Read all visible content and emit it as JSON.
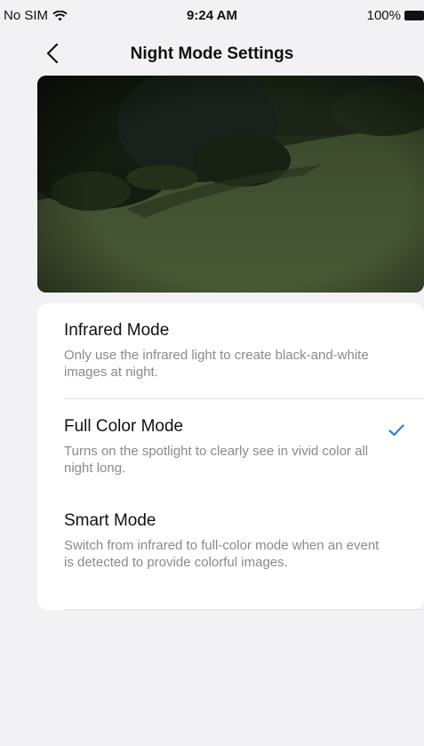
{
  "status_bar": {
    "carrier": "No SIM",
    "time": "9:24 AM",
    "battery": "100%"
  },
  "nav": {
    "title": "Night Mode Settings"
  },
  "options": [
    {
      "title": "Infrared Mode",
      "description": "Only use the infrared light to create black-and-white images at night.",
      "selected": false
    },
    {
      "title": "Full Color Mode",
      "description": "Turns on the spotlight to clearly see in vivid color all night long.",
      "selected": true
    },
    {
      "title": "Smart Mode",
      "description": "Switch from infrared to full-color mode when an event is detected to provide colorful images.",
      "selected": false
    }
  ],
  "colors": {
    "accent": "#2f7fd6",
    "background": "#f2f2f4"
  }
}
